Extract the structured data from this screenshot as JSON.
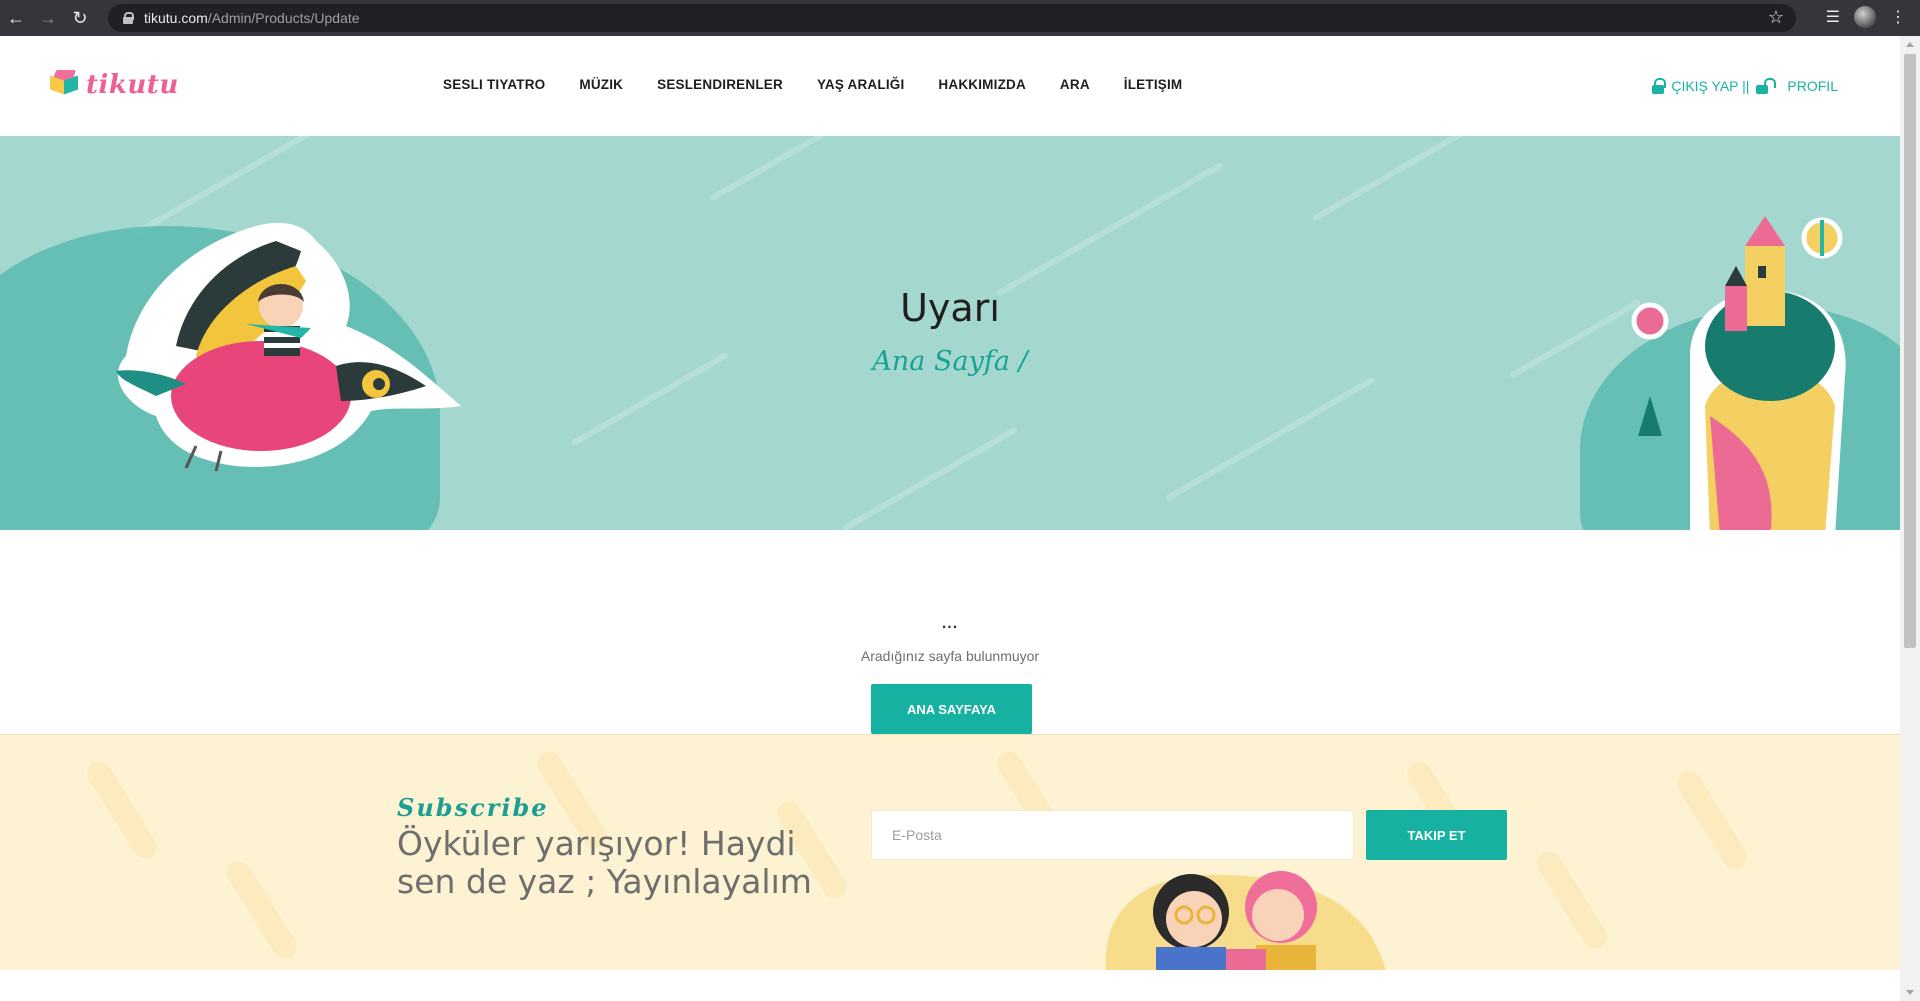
{
  "browser": {
    "url_host": "tikutu.com",
    "url_path": "/Admin/Products/Update"
  },
  "header": {
    "logo_text": "tikutu",
    "nav": [
      {
        "label": "SESLI TIYATRO"
      },
      {
        "label": "MÜZIK"
      },
      {
        "label": "SESLENDIRENLER"
      },
      {
        "label": "YAŞ ARALIĞI"
      },
      {
        "label": "HAKKIMIZDA"
      },
      {
        "label": "ARA"
      },
      {
        "label": "İLETIŞIM"
      }
    ],
    "logout_label": "ÇIKIŞ YAP ||",
    "profile_label": "PROFIL"
  },
  "hero": {
    "title": "Uyarı",
    "breadcrumb": "Ana Sayfa /"
  },
  "content": {
    "dots": "...",
    "message": "Aradığınız sayfa bulunmuyor",
    "home_button": "ANA SAYFAYA"
  },
  "subscribe": {
    "script_label": "Subscribe",
    "heading": "Öyküler yarışıyor! Haydi sen de yaz ; Yayınlayalım",
    "email_placeholder": "E-Posta",
    "button_label": "TAKIP ET"
  },
  "colors": {
    "accent": "#16b1a1",
    "hero_bg": "#a3d7cf",
    "subscribe_bg": "#fdf3d2",
    "logo_pink": "#ef5f8f"
  },
  "icons": [
    "back-arrow-icon",
    "forward-arrow-icon",
    "reload-icon",
    "lock-icon",
    "star-icon",
    "playlist-icon",
    "menu-dots-icon",
    "padlock-icon",
    "unlock-icon"
  ]
}
